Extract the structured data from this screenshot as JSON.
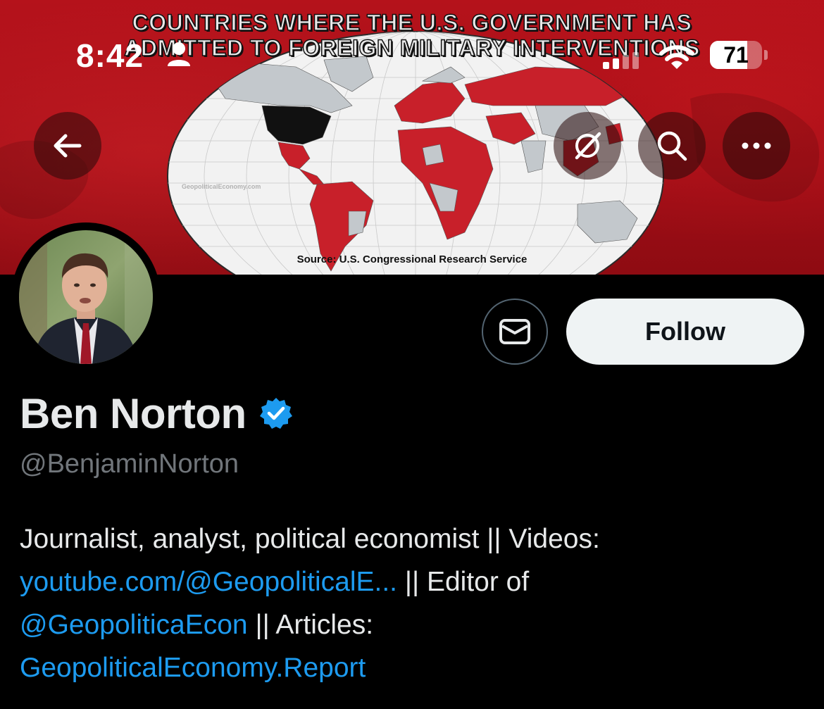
{
  "status_bar": {
    "time": "8:42",
    "battery_percent": 71,
    "battery_label": "71"
  },
  "banner": {
    "title_line1": "COUNTRIES WHERE THE U.S. GOVERNMENT HAS",
    "title_line2": "ADMITTED TO FOREIGN MILITARY INTERVENTIONS",
    "source": "Source: U.S. Congressional Research Service",
    "watermark": "GeopoliticalEconomy.com",
    "colors": {
      "background": "#a30e17",
      "intervention": "#c8202a",
      "usa": "#111111",
      "other": "#c3c8cc",
      "ocean": "#f2f2f2"
    }
  },
  "nav": {
    "back_icon": "arrow-left-icon",
    "grok_icon": "grok-slash-circle-icon",
    "search_icon": "search-icon",
    "more_icon": "more-horizontal-icon"
  },
  "profile": {
    "name": "Ben Norton",
    "verified": true,
    "handle": "@BenjaminNorton",
    "follow_label": "Follow",
    "message_icon": "envelope-icon",
    "bio": {
      "line1": "Journalist, analyst, political economist || Videos:",
      "link1": "youtube.com/@GeopoliticalE...",
      "after_link1": " || Editor of",
      "mention": "@GeopoliticaEcon",
      "after_mention": " || Articles:",
      "link2": "GeopoliticalEconomy.Report"
    }
  },
  "colors": {
    "link": "#1d9bf0",
    "verified_badge": "#1d9bf0",
    "text": "#e7e9ea",
    "muted": "#71767b",
    "follow_bg": "#eff3f4"
  }
}
